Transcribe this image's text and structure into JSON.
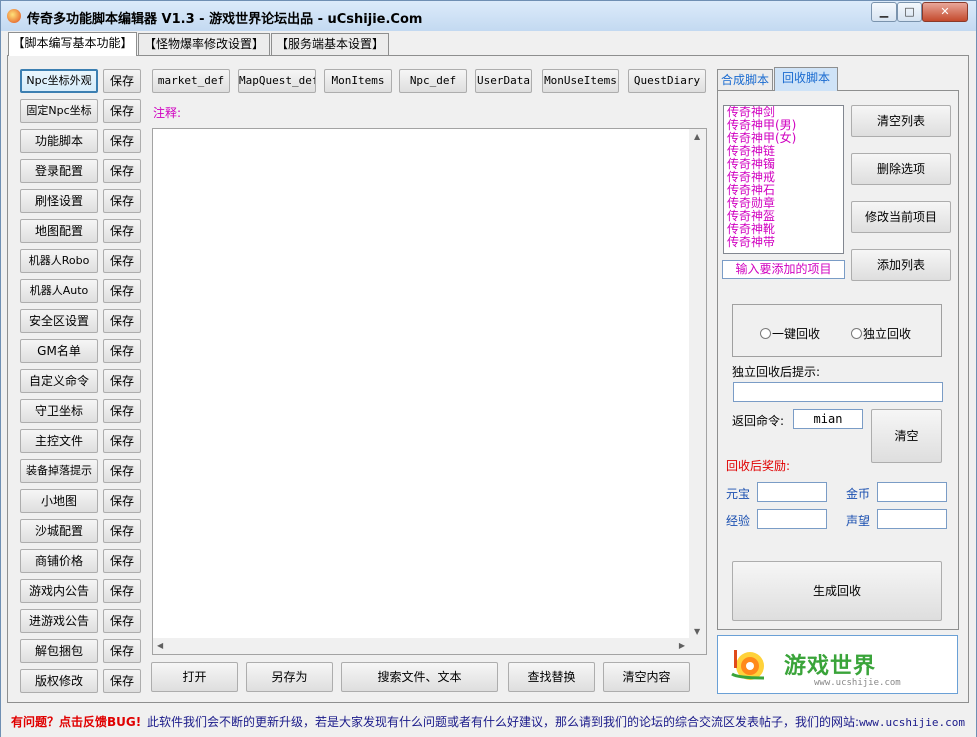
{
  "window": {
    "title": "传奇多功能脚本编辑器 V1.3 - 游戏世界论坛出品 - uCshijie.Com",
    "min_label": "▁",
    "max_label": "□",
    "close_label": "✕"
  },
  "main_tabs": [
    "【脚本编写基本功能】",
    "【怪物爆率修改设置】",
    "【服务端基本设置】"
  ],
  "left_panel": {
    "save_label": "保存",
    "items": [
      "Npc坐标外观",
      "固定Npc坐标",
      "功能脚本",
      "登录配置",
      "刷怪设置",
      "地图配置",
      "机器人Robo",
      "机器人Auto",
      "安全区设置",
      "GM名单",
      "自定义命令",
      "守卫坐标",
      "主控文件",
      "装备掉落提示",
      "小地图",
      "沙城配置",
      "商铺价格",
      "游戏内公告",
      "进游戏公告",
      "解包捆包",
      "版权修改"
    ]
  },
  "file_buttons": [
    "market_def",
    "MapQuest_def",
    "MonItems",
    "Npc_def",
    "UserData",
    "MonUseItems",
    "QuestDiary"
  ],
  "editor": {
    "comment_label": "注释:",
    "content": ""
  },
  "bottom_buttons": [
    "打开",
    "另存为",
    "搜索文件、文本",
    "查找替换",
    "清空内容"
  ],
  "sub_tabs": [
    "合成脚本",
    "回收脚本"
  ],
  "recycle": {
    "list_items": [
      "传奇神剑",
      "传奇神甲(男)",
      "传奇神甲(女)",
      "传奇神链",
      "传奇神镯",
      "传奇神戒",
      "传奇神石",
      "传奇勋章",
      "传奇神盔",
      "传奇神靴",
      "传奇神带"
    ],
    "add_input_placeholder": "输入要添加的项目",
    "clear_list_label": "清空列表",
    "delete_item_label": "删除选项",
    "modify_item_label": "修改当前项目",
    "add_list_label": "添加列表",
    "radio_onekey": "一键回收",
    "radio_single": "独立回收",
    "single_prompt_label": "独立回收后提示:",
    "single_prompt_value": "",
    "return_cmd_label": "返回命令:",
    "return_cmd_value": "mian",
    "clear_label": "清空",
    "reward_label": "回收后奖励:",
    "yuanbao_label": "元宝",
    "gold_label": "金币",
    "exp_label": "经验",
    "prestige_label": "声望",
    "yuanbao_value": "",
    "gold_value": "",
    "exp_value": "",
    "prestige_value": "",
    "generate_label": "生成回收"
  },
  "logo": {
    "brand_text": "游戏世界",
    "url_text": "www.ucshijie.com"
  },
  "status": {
    "feedback_text": "有问题？点击反馈BUG!",
    "info_text": "此软件我们会不断的更新升级，若是大家发现有什么问题或者有什么好建议，那么请到我们的论坛的综合交流区发表帖子，我们的网站:",
    "url_text": "www.ucshijie.com"
  },
  "colors": {
    "accent_magenta": "#d000c0",
    "reward_red": "#e00000",
    "link_blue": "#1a1a8a",
    "logo_green": "#3aa43a"
  }
}
